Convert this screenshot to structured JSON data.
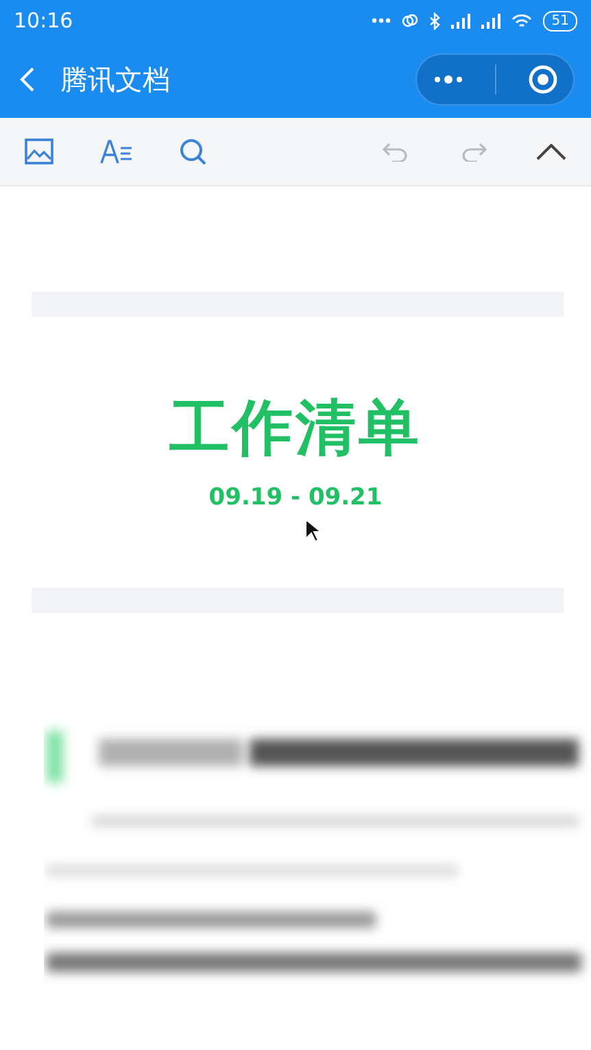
{
  "status_bar": {
    "time": "10:16",
    "battery": "51"
  },
  "nav_bar": {
    "title": "腾讯文档"
  },
  "toolbar": {
    "undo_disabled": true,
    "redo_disabled": true
  },
  "document": {
    "title": "工作清单",
    "date_range": "09.19 - 09.21"
  }
}
